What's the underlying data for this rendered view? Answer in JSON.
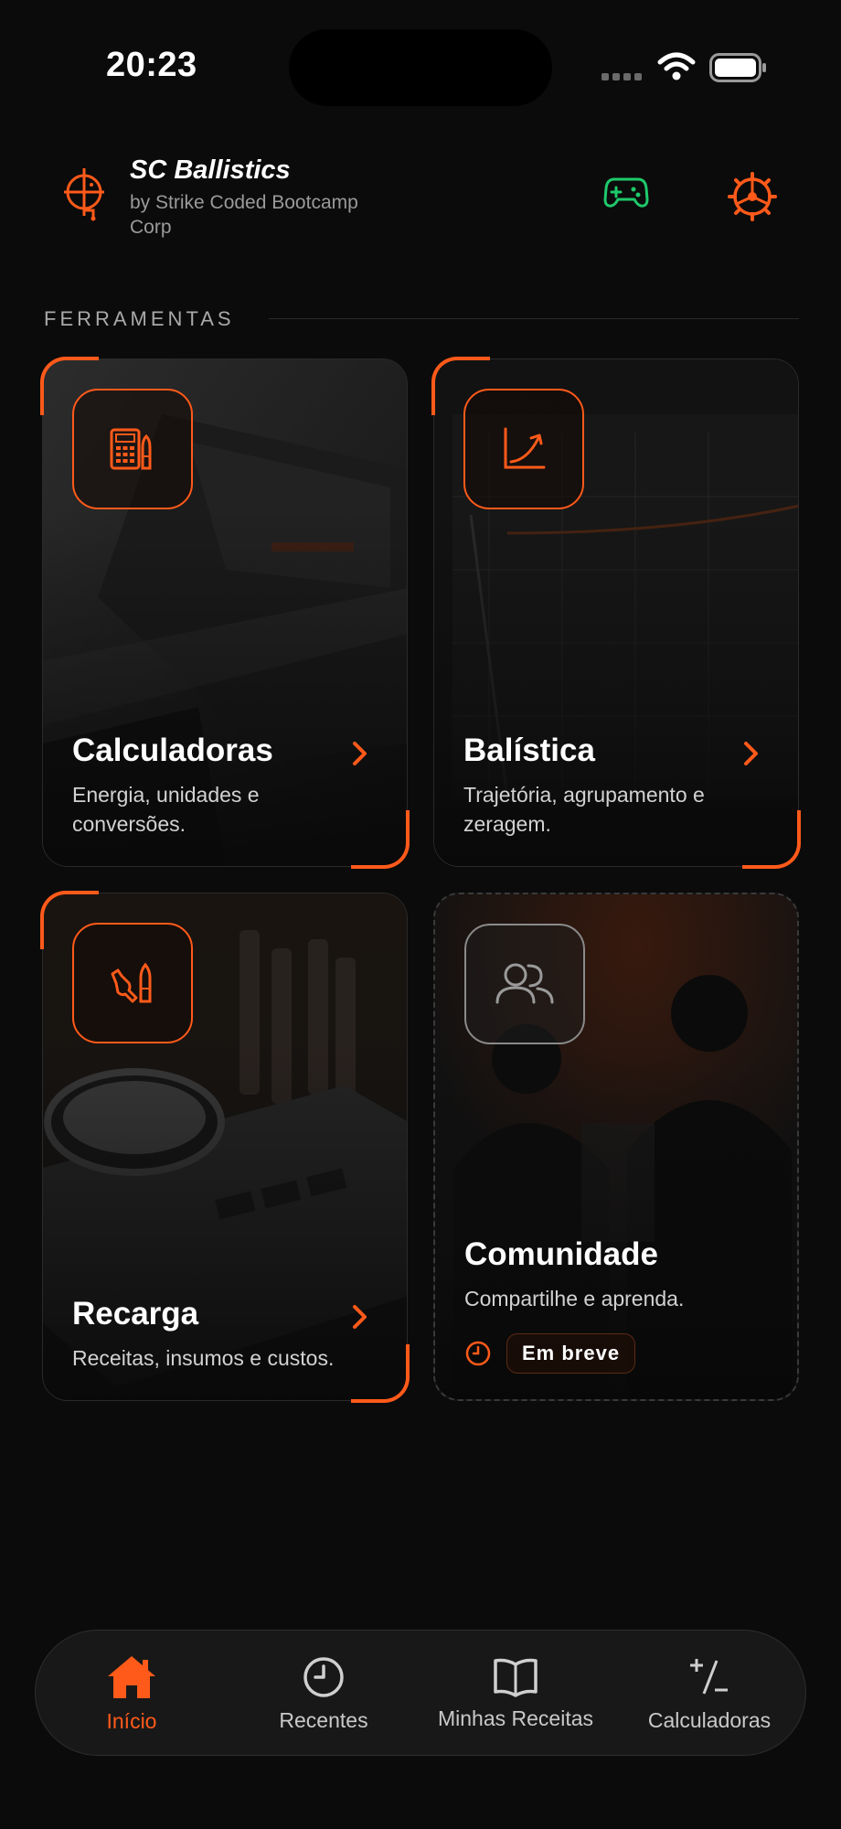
{
  "status": {
    "time": "20:23"
  },
  "header": {
    "title": "SC Ballistics",
    "subtitle": "by Strike Coded Bootcamp Corp",
    "logo_icon": "crosshair-logo-icon",
    "gamepad_icon": "gamepad-icon",
    "settings_icon": "gear-icon"
  },
  "section": {
    "title": "FERRAMENTAS"
  },
  "cards": [
    {
      "title": "Calculadoras",
      "desc": "Energia, unidades e conversões.",
      "icon": "calculator-icon"
    },
    {
      "title": "Balística",
      "desc": "Trajetória, agrupamento e zeragem.",
      "icon": "trajectory-chart-icon"
    },
    {
      "title": "Recarga",
      "desc": "Receitas, insumos e custos.",
      "icon": "reloading-tools-icon"
    },
    {
      "title": "Comunidade",
      "desc": "Compartilhe e aprenda.",
      "icon": "community-icon",
      "badge": "Em breve"
    }
  ],
  "tabs": [
    {
      "label": "Início",
      "icon": "home-icon",
      "active": true
    },
    {
      "label": "Recentes",
      "icon": "clock-icon",
      "active": false
    },
    {
      "label": "Minhas Receitas",
      "icon": "book-icon",
      "active": false
    },
    {
      "label": "Calculadoras",
      "icon": "plus-minus-icon",
      "active": false
    }
  ],
  "colors": {
    "accent": "#ff5a1a",
    "green": "#1fc96b",
    "background": "#0b0b0b"
  }
}
